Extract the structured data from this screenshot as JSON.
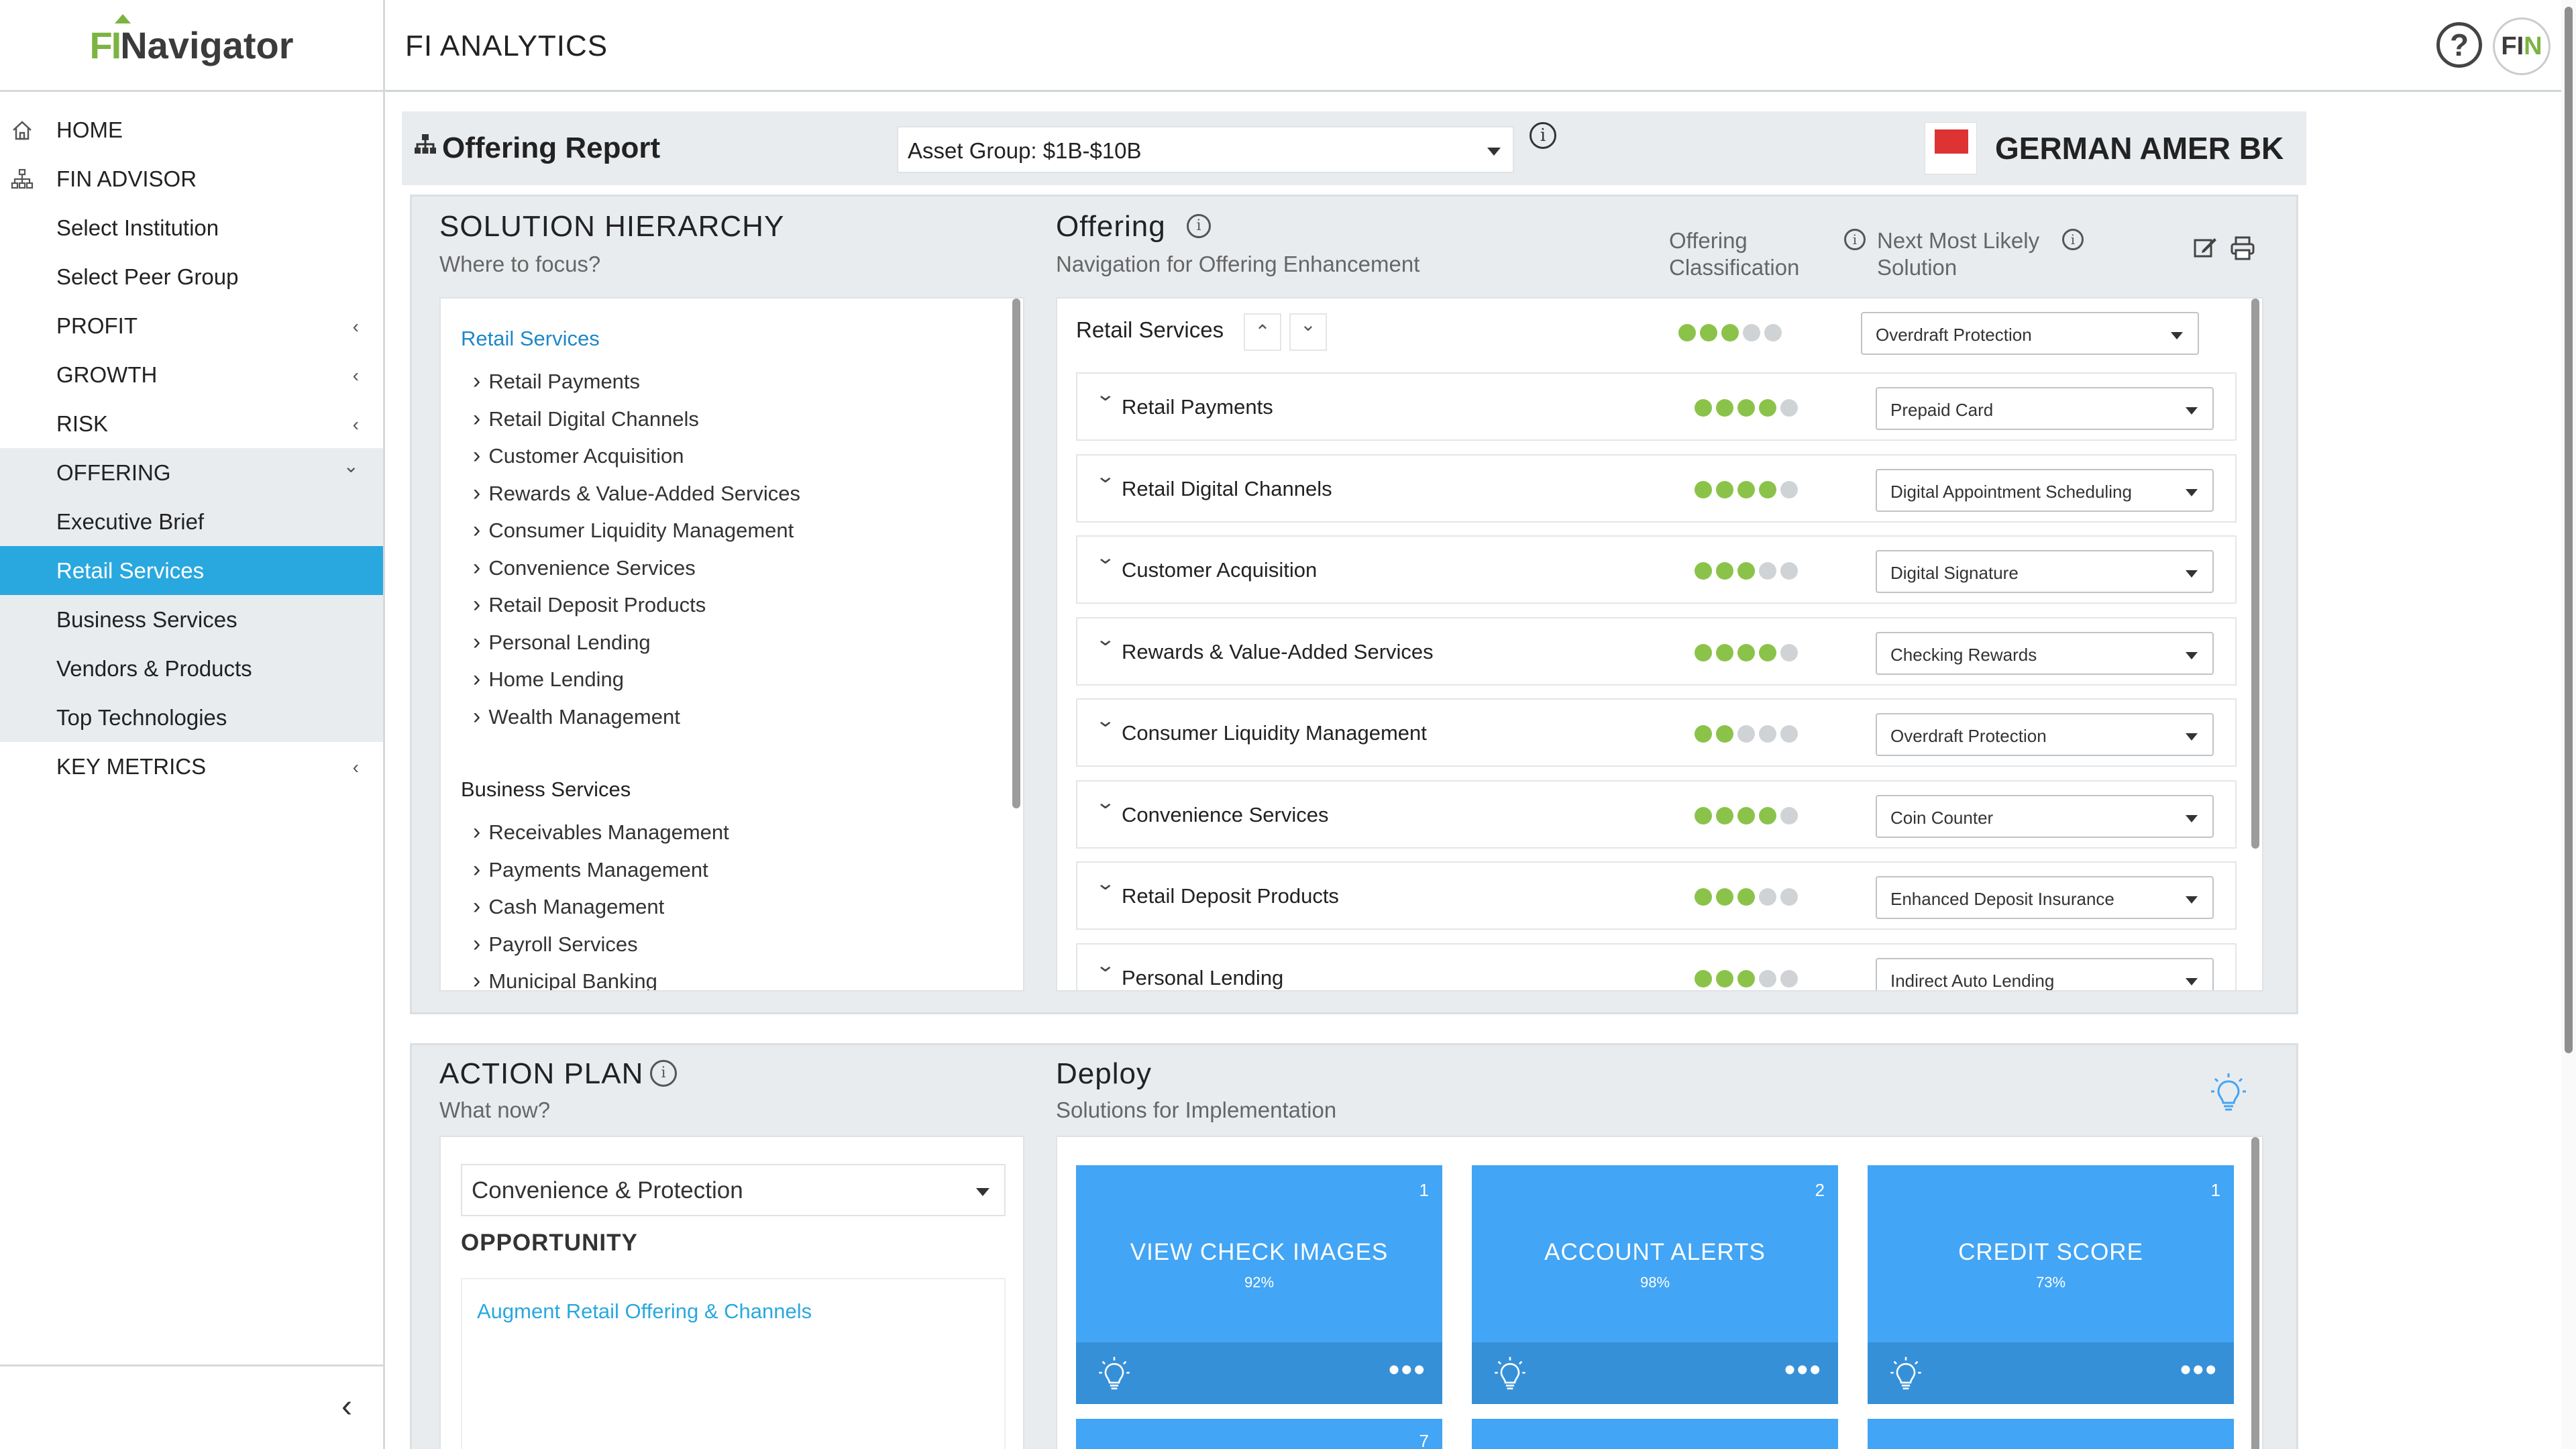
{
  "brand": {
    "logo_fi": "FI",
    "logo_nav": "Navigator"
  },
  "app_title": "FI ANALYTICS",
  "header": {
    "help": "?",
    "avatar": "FIN"
  },
  "sidebar": {
    "items": [
      {
        "label": "HOME",
        "type": "top",
        "icon": "home-icon"
      },
      {
        "label": "FIN ADVISOR",
        "type": "top",
        "icon": "org-chart-icon"
      },
      {
        "label": "Select Institution",
        "type": "sub"
      },
      {
        "label": "Select Peer Group",
        "type": "sub"
      },
      {
        "label": "PROFIT",
        "type": "section"
      },
      {
        "label": "GROWTH",
        "type": "section"
      },
      {
        "label": "RISK",
        "type": "section"
      },
      {
        "label": "OFFERING",
        "type": "section-open"
      },
      {
        "label": "Executive Brief",
        "type": "child"
      },
      {
        "label": "Retail Services",
        "type": "child-active"
      },
      {
        "label": "Business Services",
        "type": "child"
      },
      {
        "label": "Vendors & Products",
        "type": "child"
      },
      {
        "label": "Top Technologies",
        "type": "child"
      },
      {
        "label": "KEY METRICS",
        "type": "section"
      }
    ]
  },
  "report": {
    "title": "Offering Report",
    "asset_group": "Asset Group: $1B-$10B",
    "institution": "GERMAN AMER BK"
  },
  "hierarchy": {
    "title": "SOLUTION HIERARCHY",
    "subtitle": "Where to focus?",
    "retail_label": "Retail Services",
    "retail_items": [
      "Retail Payments",
      "Retail Digital Channels",
      "Customer Acquisition",
      "Rewards & Value-Added Services",
      "Consumer Liquidity Management",
      "Convenience Services",
      "Retail Deposit Products",
      "Personal Lending",
      "Home Lending",
      "Wealth Management"
    ],
    "business_label": "Business Services",
    "business_items": [
      "Receivables Management",
      "Payments Management",
      "Cash Management",
      "Payroll Services",
      "Municipal Banking"
    ]
  },
  "offering": {
    "title": "Offering",
    "subtitle": "Navigation for Offering Enhancement",
    "col_class": "Offering Classification",
    "col_next": "Next Most Likely Solution",
    "header_row": {
      "label": "Retail Services",
      "dots": 3,
      "solution": "Overdraft Protection"
    },
    "rows": [
      {
        "label": "Retail Payments",
        "dots": 4,
        "solution": "Prepaid Card"
      },
      {
        "label": "Retail Digital Channels",
        "dots": 4,
        "solution": "Digital Appointment Scheduling"
      },
      {
        "label": "Customer Acquisition",
        "dots": 3,
        "solution": "Digital Signature"
      },
      {
        "label": "Rewards & Value-Added Services",
        "dots": 4,
        "solution": "Checking Rewards"
      },
      {
        "label": "Consumer Liquidity Management",
        "dots": 2,
        "solution": "Overdraft Protection"
      },
      {
        "label": "Convenience Services",
        "dots": 4,
        "solution": "Coin Counter"
      },
      {
        "label": "Retail Deposit Products",
        "dots": 3,
        "solution": "Enhanced Deposit Insurance"
      },
      {
        "label": "Personal Lending",
        "dots": 3,
        "solution": "Indirect Auto Lending"
      }
    ]
  },
  "action_plan": {
    "title": "ACTION PLAN",
    "subtitle": "What now?",
    "select": "Convenience & Protection",
    "opportunity_label": "OPPORTUNITY",
    "opportunity_link": "Augment Retail Offering & Channels"
  },
  "deploy": {
    "title": "Deploy",
    "subtitle": "Solutions for Implementation",
    "cards": [
      {
        "num": "1",
        "name": "VIEW CHECK IMAGES",
        "pct": "92%"
      },
      {
        "num": "2",
        "name": "ACCOUNT ALERTS",
        "pct": "98%"
      },
      {
        "num": "1",
        "name": "CREDIT SCORE",
        "pct": "73%"
      }
    ],
    "more": "•••",
    "second_row_num": "7"
  },
  "colors": {
    "accent": "#29a8df",
    "brand_green": "#7cb342",
    "card": "#42a5f5",
    "dot_on": "#8bc34a"
  }
}
